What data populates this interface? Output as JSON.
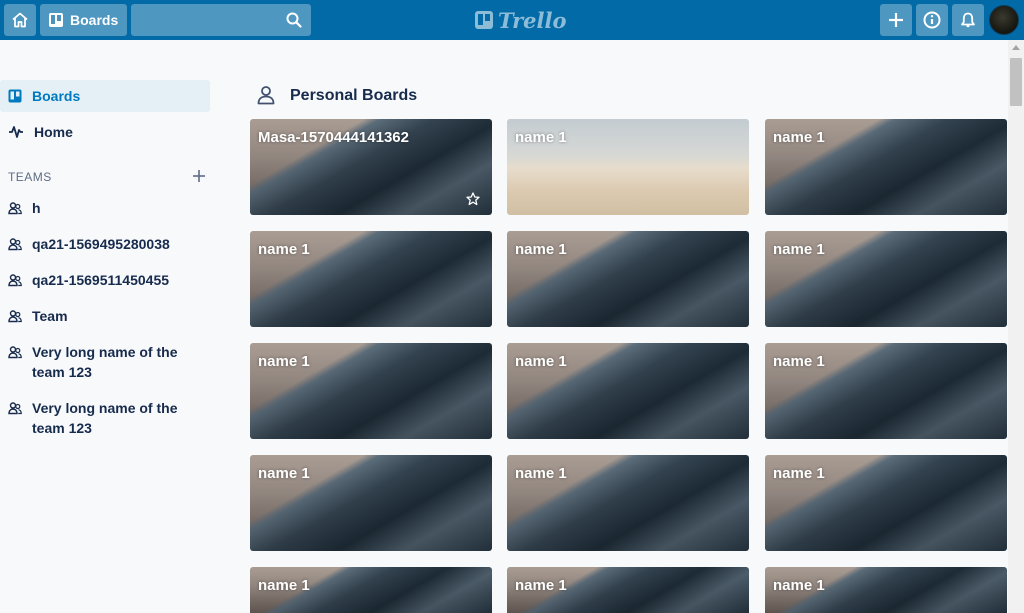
{
  "header": {
    "boards_label": "Boards",
    "search_value": "",
    "logo_text": "Trello",
    "brand_color": "#026aa7"
  },
  "sidebar": {
    "nav": [
      {
        "label": "Boards",
        "icon": "boards-icon",
        "active": true
      },
      {
        "label": "Home",
        "icon": "activity-icon",
        "active": false
      }
    ],
    "teams_header": "TEAMS",
    "teams": [
      {
        "label": "h",
        "icon": "team-icon"
      },
      {
        "label": "qa21-1569495280038",
        "icon": "team-icon"
      },
      {
        "label": "qa21-1569511450455",
        "icon": "team-icon"
      },
      {
        "label": "Team",
        "icon": "team-icon"
      },
      {
        "label": "Very long name of the team 123",
        "icon": "team-icon"
      },
      {
        "label": "Very long name of the team 123",
        "icon": "team-icon"
      }
    ]
  },
  "main": {
    "section_title": "Personal Boards",
    "boards": [
      {
        "title": "Masa-1570444141362",
        "background": "mountain",
        "starred_icon": "star-icon"
      },
      {
        "title": "name 1",
        "background": "desert"
      },
      {
        "title": "name 1",
        "background": "mountain"
      },
      {
        "title": "name 1",
        "background": "mountain"
      },
      {
        "title": "name 1",
        "background": "mountain"
      },
      {
        "title": "name 1",
        "background": "mountain"
      },
      {
        "title": "name 1",
        "background": "mountain"
      },
      {
        "title": "name 1",
        "background": "mountain"
      },
      {
        "title": "name 1",
        "background": "mountain"
      },
      {
        "title": "name 1",
        "background": "mountain"
      },
      {
        "title": "name 1",
        "background": "mountain"
      },
      {
        "title": "name 1",
        "background": "mountain"
      },
      {
        "title": "name 1",
        "background": "mountain"
      },
      {
        "title": "name 1",
        "background": "mountain"
      },
      {
        "title": "name 1",
        "background": "mountain"
      }
    ]
  }
}
